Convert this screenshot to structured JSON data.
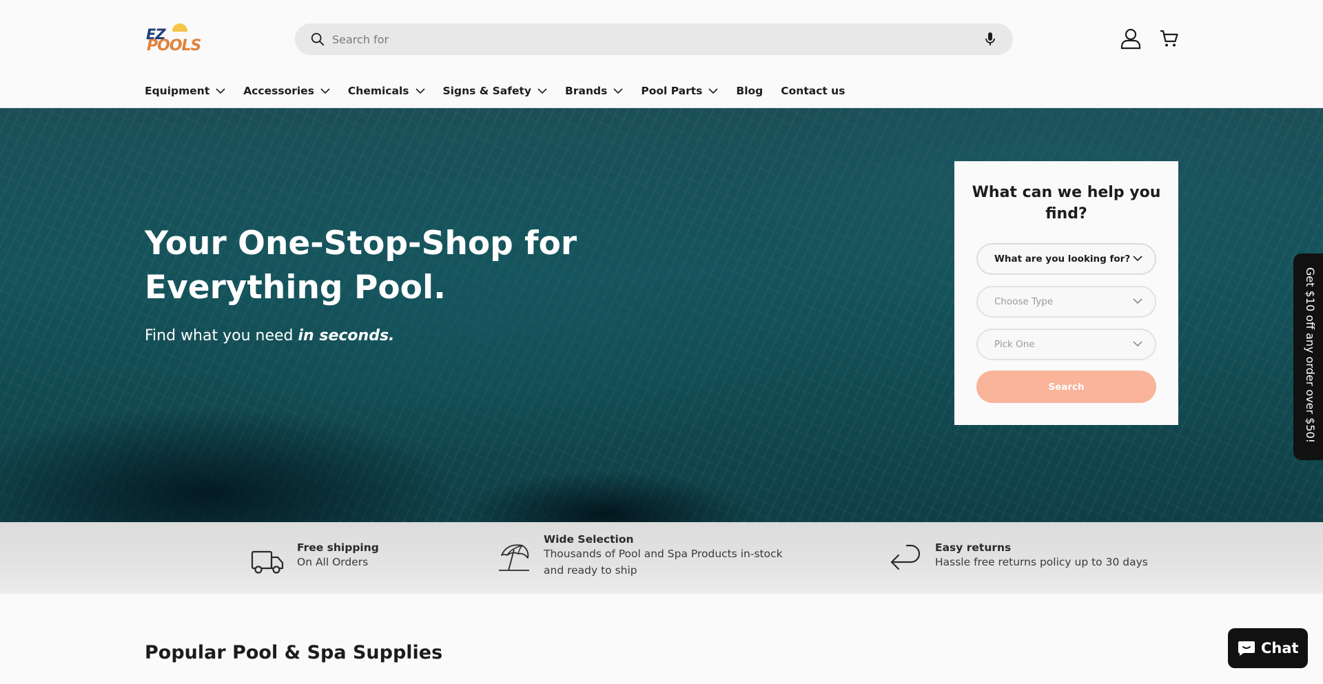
{
  "header": {
    "logo": {
      "line1": "EZ",
      "line2": "POOLS"
    },
    "search": {
      "placeholder": "Search for"
    }
  },
  "nav": {
    "items": [
      {
        "label": "Equipment",
        "has_dropdown": true
      },
      {
        "label": "Accessories",
        "has_dropdown": true
      },
      {
        "label": "Chemicals",
        "has_dropdown": true
      },
      {
        "label": "Signs & Safety",
        "has_dropdown": true
      },
      {
        "label": "Brands",
        "has_dropdown": true
      },
      {
        "label": "Pool Parts",
        "has_dropdown": true
      },
      {
        "label": "Blog",
        "has_dropdown": false
      },
      {
        "label": "Contact us",
        "has_dropdown": false
      }
    ]
  },
  "hero": {
    "title": "Your One-Stop-Shop for Everything Pool.",
    "subtitle_prefix": "Find what you need ",
    "subtitle_emphasis": "in seconds."
  },
  "finder": {
    "title": "What can we help you find?",
    "select_1": "What are you looking for?",
    "select_2": "Choose Type",
    "select_3": "Pick One",
    "button": "Search"
  },
  "promo": {
    "text": "Get $10 off any order over $50!"
  },
  "features": [
    {
      "icon": "truck-icon",
      "title": "Free shipping",
      "desc": "On All Orders"
    },
    {
      "icon": "umbrella-icon",
      "title": "Wide Selection",
      "desc": "Thousands of Pool and Spa Products in-stock and ready to ship"
    },
    {
      "icon": "return-arrow-icon",
      "title": "Easy returns",
      "desc": "Hassle free returns policy up to 30 days"
    }
  ],
  "section": {
    "title": "Popular Pool & Spa Supplies"
  },
  "chat": {
    "label": "Chat"
  },
  "colors": {
    "accent_button": "#f9b49a",
    "logo_blue": "#1f3f7a",
    "logo_orange": "#e0823c",
    "hero_water": "#15535b"
  }
}
